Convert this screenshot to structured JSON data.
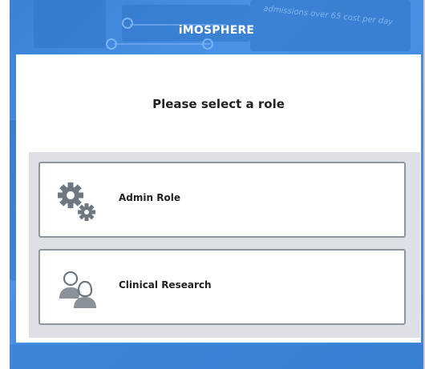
{
  "app": {
    "title": "iMOSPHERE"
  },
  "background": {
    "caption": "admissions over 65 cost per day"
  },
  "dialog": {
    "heading": "Please select a role",
    "roles": [
      {
        "label": "Admin Role",
        "icon": "gears-icon"
      },
      {
        "label": "Clinical Research",
        "icon": "users-icon"
      }
    ]
  },
  "colors": {
    "brand_blue": "#3a82d6",
    "panel_gray": "#dde1e6",
    "card_border": "#8e969f",
    "icon_gray": "#6f7780"
  }
}
